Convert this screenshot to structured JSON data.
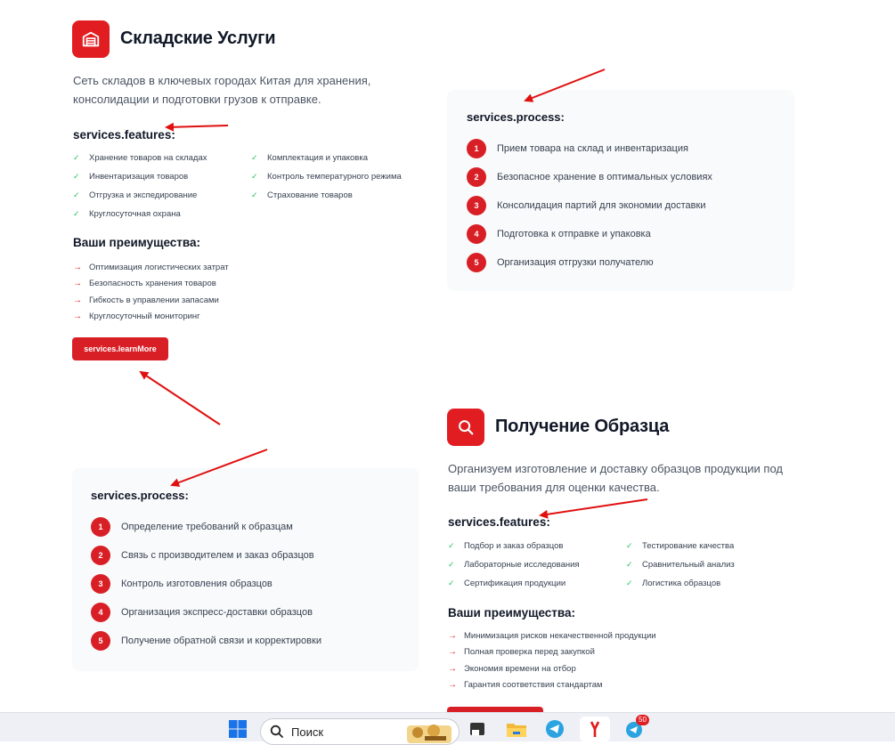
{
  "warehouse": {
    "title": "Складские Услуги",
    "description": "Сеть складов в ключевых городах Китая для хранения, консолидации и подготовки грузов к отправке.",
    "features_heading": "services.features:",
    "features": [
      "Хранение товаров на складах",
      "Комплектация и упаковка",
      "Инвентаризация товаров",
      "Контроль температурного режима",
      "Отгрузка и экспедирование",
      "Страхование товаров",
      "Круглосуточная охрана"
    ],
    "advantages_heading": "Ваши преимущества:",
    "advantages": [
      "Оптимизация логистических затрат",
      "Безопасность хранения товаров",
      "Гибкость в управлении запасами",
      "Круглосуточный мониторинг"
    ],
    "learn_more": "services.learnMore",
    "process_heading": "services.process:",
    "process": [
      {
        "num": "1",
        "text": "Прием товара на склад и инвентаризация"
      },
      {
        "num": "2",
        "text": "Безопасное хранение в оптимальных условиях"
      },
      {
        "num": "3",
        "text": "Консолидация партий для экономии доставки"
      },
      {
        "num": "4",
        "text": "Подготовка к отправке и упаковка"
      },
      {
        "num": "5",
        "text": "Организация отгрузки получателю"
      }
    ]
  },
  "sample": {
    "title": "Получение Образца",
    "description": "Организуем изготовление и доставку образцов продукции под ваши требования для оценки качества.",
    "features_heading": "services.features:",
    "features": [
      "Подбор и заказ образцов",
      "Тестирование качества",
      "Лабораторные исследования",
      "Сравнительный анализ",
      "Сертификация продукции",
      "Логистика образцов"
    ],
    "advantages_heading": "Ваши преимущества:",
    "advantages": [
      "Минимизация рисков некачественной продукции",
      "Полная проверка перед закупкой",
      "Экономия времени на отбор",
      "Гарантия соответствия стандартам"
    ],
    "process_heading": "services.process:",
    "process": [
      {
        "num": "1",
        "text": "Определение требований к образцам"
      },
      {
        "num": "2",
        "text": "Связь с производителем и заказ образцов"
      },
      {
        "num": "3",
        "text": "Контроль изготовления образцов"
      },
      {
        "num": "4",
        "text": "Организация экспресс-доставки образцов"
      },
      {
        "num": "5",
        "text": "Получение обратной связи и корректировки"
      }
    ]
  },
  "taskbar": {
    "search_label": "Поиск",
    "telegram_badge": "50"
  },
  "colors": {
    "accent": "#d91f26",
    "check": "#22c55e",
    "annotation": "#e01010"
  }
}
